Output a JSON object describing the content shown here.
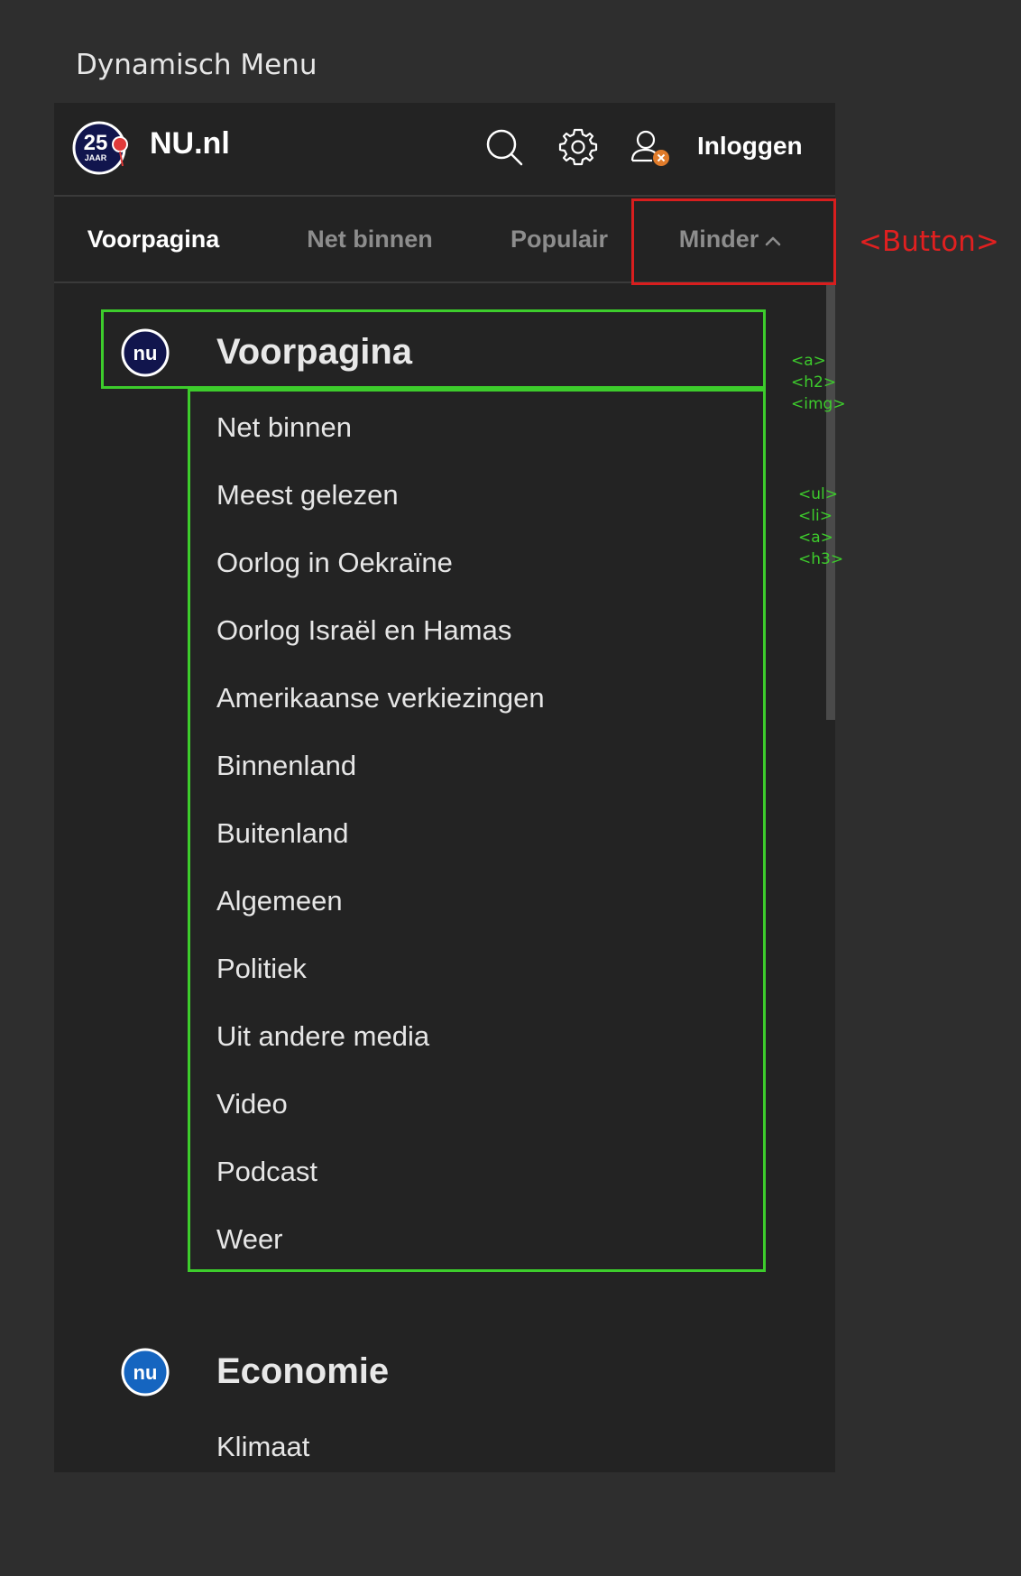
{
  "page_label": "Dynamisch Menu",
  "header": {
    "logo_icon": "nu-25-jaar-logo",
    "brand": "NU.nl",
    "search_icon": "search-icon",
    "settings_icon": "gear-icon",
    "user_icon": "user-icon",
    "login_label": "Inloggen"
  },
  "tabs": [
    {
      "label": "Voorpagina",
      "active": true
    },
    {
      "label": "Net binnen",
      "active": false
    },
    {
      "label": "Populair",
      "active": false
    },
    {
      "label": "Minder",
      "active": false
    }
  ],
  "sections": [
    {
      "title": "Voorpagina",
      "icon": "nu-logo-icon",
      "items": [
        "Net binnen",
        "Meest gelezen",
        "Oorlog in Oekraïne",
        "Oorlog Israël en Hamas",
        "Amerikaanse verkiezingen",
        "Binnenland",
        "Buitenland",
        "Algemeen",
        "Politiek",
        "Uit andere media",
        "Video",
        "Podcast",
        "Weer"
      ]
    },
    {
      "title": "Economie",
      "icon": "nu-logo-icon",
      "items": [
        "Klimaat"
      ]
    }
  ],
  "annotations": {
    "button_label": "<Button>",
    "heading_tags": [
      "<a>",
      "<h2>",
      "<img>"
    ],
    "list_tags": [
      "<ul>",
      "<li>",
      "<a>",
      "<h3>"
    ]
  },
  "colors": {
    "background": "#2e2e2e",
    "panel": "#232323",
    "annotation_red": "#d81e1e",
    "annotation_green": "#3dcc2c",
    "notification_badge": "#e07b2a",
    "voorpagina_icon": "#11154d",
    "economie_icon": "#1565c0"
  }
}
